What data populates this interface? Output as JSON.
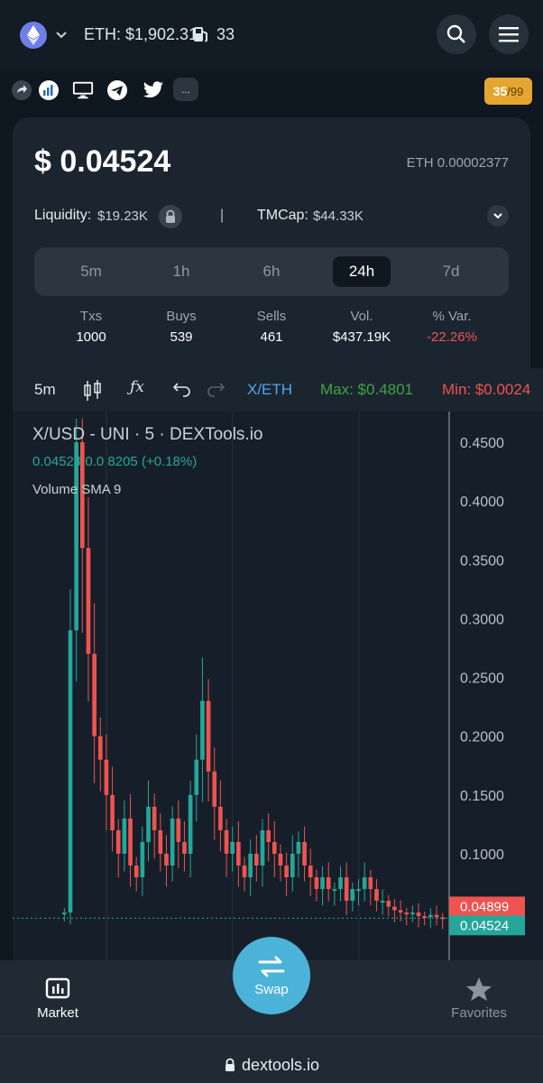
{
  "header": {
    "eth_price": "ETH: $1,902.31",
    "gas": "33",
    "icons": [
      "ethereum-icon",
      "chevron-down-icon",
      "gas-pump-icon",
      "search-icon",
      "menu-icon"
    ]
  },
  "social": {
    "icons": [
      "share-icon",
      "chart-logo-icon",
      "website-icon",
      "telegram-icon",
      "twitter-icon"
    ],
    "more": "...",
    "score_value": "35",
    "score_max": "/99"
  },
  "token": {
    "price": "$ 0.04524",
    "price_eth": "ETH 0.00002377",
    "liquidity_label": "Liquidity:",
    "liquidity_value": "$19.23K",
    "separator": "|",
    "tmcap_label": "TMCap:",
    "tmcap_value": "$44.33K"
  },
  "timeframes": [
    "5m",
    "1h",
    "6h",
    "24h",
    "7d"
  ],
  "active_timeframe": "24h",
  "stats": [
    {
      "label": "Txs",
      "value": "1000"
    },
    {
      "label": "Buys",
      "value": "539"
    },
    {
      "label": "Sells",
      "value": "461"
    },
    {
      "label": "Vol.",
      "value": "$437.19K"
    },
    {
      "label": "% Var.",
      "value": "-22.26%"
    }
  ],
  "chart_toolbar": {
    "interval": "5m",
    "pair_toggle": "X/ETH",
    "max": "Max: $0.4801",
    "min": "Min: $0.0024"
  },
  "chart_data": {
    "type": "candlestick",
    "title": "X/USD - UNI · 5 · DEXTools.io",
    "ohlc_line": "0.04524  0.0 8205 (+0.18%)",
    "indicator": "Volume SMA 9",
    "y_ticks": [
      "0.4500",
      "0.4000",
      "0.3500",
      "0.3000",
      "0.2500",
      "0.2000",
      "0.1500",
      "0.1000"
    ],
    "ylim": [
      0.03,
      0.48
    ],
    "last_price_label": "0.04524",
    "prev_price_label": "0.04899",
    "series": [
      {
        "name": "price",
        "values": [
          0.05,
          0.29,
          0.45,
          0.36,
          0.27,
          0.2,
          0.18,
          0.15,
          0.12,
          0.1,
          0.13,
          0.09,
          0.08,
          0.11,
          0.14,
          0.12,
          0.1,
          0.09,
          0.13,
          0.11,
          0.1,
          0.15,
          0.18,
          0.23,
          0.17,
          0.14,
          0.12,
          0.1,
          0.11,
          0.09,
          0.08,
          0.1,
          0.09,
          0.12,
          0.11,
          0.1,
          0.09,
          0.08,
          0.1,
          0.11,
          0.09,
          0.08,
          0.07,
          0.08,
          0.07,
          0.07,
          0.08,
          0.06,
          0.07,
          0.07,
          0.08,
          0.07,
          0.06,
          0.06,
          0.055,
          0.052,
          0.05,
          0.049,
          0.05,
          0.047,
          0.046,
          0.048,
          0.046,
          0.045
        ]
      }
    ],
    "colors": {
      "up": "#26a69a",
      "down": "#ef5350"
    }
  },
  "nav": {
    "market": "Market",
    "swap": "Swap",
    "favorites": "Favorites"
  },
  "url": "dextools.io"
}
